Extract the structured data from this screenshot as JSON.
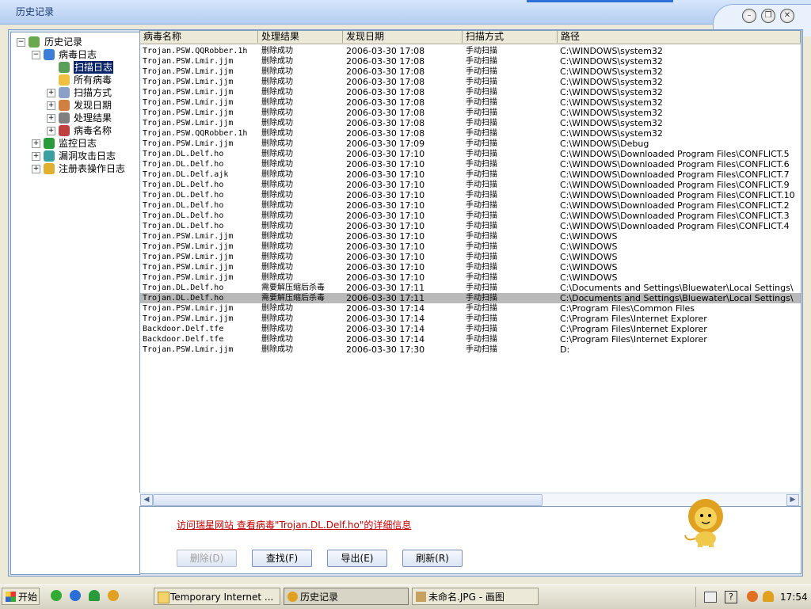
{
  "window": {
    "title": "历史记录"
  },
  "tree": [
    {
      "label": "历史记录"
    },
    {
      "label": "病毒日志"
    },
    {
      "label": "扫描日志"
    },
    {
      "label": "所有病毒"
    },
    {
      "label": "扫描方式"
    },
    {
      "label": "发现日期"
    },
    {
      "label": "处理结果"
    },
    {
      "label": "病毒名称"
    },
    {
      "label": "监控日志"
    },
    {
      "label": "漏洞攻击日志"
    },
    {
      "label": "注册表操作日志"
    }
  ],
  "columns": [
    "病毒名称",
    "处理结果",
    "发现日期",
    "扫描方式",
    "路径"
  ],
  "rows": [
    [
      "Trojan.PSW.QQRobber.1h",
      "删除成功",
      "2006-03-30  17:08",
      "手动扫描",
      "C:\\WINDOWS\\system32"
    ],
    [
      "Trojan.PSW.Lmir.jjm",
      "删除成功",
      "2006-03-30  17:08",
      "手动扫描",
      "C:\\WINDOWS\\system32"
    ],
    [
      "Trojan.PSW.Lmir.jjm",
      "删除成功",
      "2006-03-30  17:08",
      "手动扫描",
      "C:\\WINDOWS\\system32"
    ],
    [
      "Trojan.PSW.Lmir.jjm",
      "删除成功",
      "2006-03-30  17:08",
      "手动扫描",
      "C:\\WINDOWS\\system32"
    ],
    [
      "Trojan.PSW.Lmir.jjm",
      "删除成功",
      "2006-03-30  17:08",
      "手动扫描",
      "C:\\WINDOWS\\system32"
    ],
    [
      "Trojan.PSW.Lmir.jjm",
      "删除成功",
      "2006-03-30  17:08",
      "手动扫描",
      "C:\\WINDOWS\\system32"
    ],
    [
      "Trojan.PSW.Lmir.jjm",
      "删除成功",
      "2006-03-30  17:08",
      "手动扫描",
      "C:\\WINDOWS\\system32"
    ],
    [
      "Trojan.PSW.Lmir.jjm",
      "删除成功",
      "2006-03-30  17:08",
      "手动扫描",
      "C:\\WINDOWS\\system32"
    ],
    [
      "Trojan.PSW.QQRobber.1h",
      "删除成功",
      "2006-03-30  17:08",
      "手动扫描",
      "C:\\WINDOWS\\system32"
    ],
    [
      "Trojan.PSW.Lmir.jjm",
      "删除成功",
      "2006-03-30  17:09",
      "手动扫描",
      "C:\\WINDOWS\\Debug"
    ],
    [
      "Trojan.DL.Delf.ho",
      "删除成功",
      "2006-03-30  17:10",
      "手动扫描",
      "C:\\WINDOWS\\Downloaded Program Files\\CONFLICT.5"
    ],
    [
      "Trojan.DL.Delf.ho",
      "删除成功",
      "2006-03-30  17:10",
      "手动扫描",
      "C:\\WINDOWS\\Downloaded Program Files\\CONFLICT.6"
    ],
    [
      "Trojan.DL.Delf.ajk",
      "删除成功",
      "2006-03-30  17:10",
      "手动扫描",
      "C:\\WINDOWS\\Downloaded Program Files\\CONFLICT.7"
    ],
    [
      "Trojan.DL.Delf.ho",
      "删除成功",
      "2006-03-30  17:10",
      "手动扫描",
      "C:\\WINDOWS\\Downloaded Program Files\\CONFLICT.9"
    ],
    [
      "Trojan.DL.Delf.ho",
      "删除成功",
      "2006-03-30  17:10",
      "手动扫描",
      "C:\\WINDOWS\\Downloaded Program Files\\CONFLICT.10"
    ],
    [
      "Trojan.DL.Delf.ho",
      "删除成功",
      "2006-03-30  17:10",
      "手动扫描",
      "C:\\WINDOWS\\Downloaded Program Files\\CONFLICT.2"
    ],
    [
      "Trojan.DL.Delf.ho",
      "删除成功",
      "2006-03-30  17:10",
      "手动扫描",
      "C:\\WINDOWS\\Downloaded Program Files\\CONFLICT.3"
    ],
    [
      "Trojan.DL.Delf.ho",
      "删除成功",
      "2006-03-30  17:10",
      "手动扫描",
      "C:\\WINDOWS\\Downloaded Program Files\\CONFLICT.4"
    ],
    [
      "Trojan.PSW.Lmir.jjm",
      "删除成功",
      "2006-03-30  17:10",
      "手动扫描",
      "C:\\WINDOWS"
    ],
    [
      "Trojan.PSW.Lmir.jjm",
      "删除成功",
      "2006-03-30  17:10",
      "手动扫描",
      "C:\\WINDOWS"
    ],
    [
      "Trojan.PSW.Lmir.jjm",
      "删除成功",
      "2006-03-30  17:10",
      "手动扫描",
      "C:\\WINDOWS"
    ],
    [
      "Trojan.PSW.Lmir.jjm",
      "删除成功",
      "2006-03-30  17:10",
      "手动扫描",
      "C:\\WINDOWS"
    ],
    [
      "Trojan.PSW.Lmir.jjm",
      "删除成功",
      "2006-03-30  17:10",
      "手动扫描",
      "C:\\WINDOWS"
    ],
    [
      "Trojan.DL.Delf.ho",
      "需要解压缩后杀毒",
      "2006-03-30  17:11",
      "手动扫描",
      "C:\\Documents and Settings\\Bluewater\\Local Settings\\"
    ],
    [
      "Trojan.DL.Delf.ho",
      "需要解压缩后杀毒",
      "2006-03-30  17:11",
      "手动扫描",
      "C:\\Documents and Settings\\Bluewater\\Local Settings\\"
    ],
    [
      "Trojan.PSW.Lmir.jjm",
      "删除成功",
      "2006-03-30  17:14",
      "手动扫描",
      "C:\\Program Files\\Common Files"
    ],
    [
      "Trojan.PSW.Lmir.jjm",
      "删除成功",
      "2006-03-30  17:14",
      "手动扫描",
      "C:\\Program Files\\Internet Explorer"
    ],
    [
      "Backdoor.Delf.tfe",
      "删除成功",
      "2006-03-30  17:14",
      "手动扫描",
      "C:\\Program Files\\Internet Explorer"
    ],
    [
      "Backdoor.Delf.tfe",
      "删除成功",
      "2006-03-30  17:14",
      "手动扫描",
      "C:\\Program Files\\Internet Explorer"
    ],
    [
      "Trojan.PSW.Lmir.jjm",
      "删除成功",
      "2006-03-30  17:30",
      "手动扫描",
      "D:"
    ]
  ],
  "selected_row": 24,
  "info_link": "访问瑞星网站 查看病毒\"Trojan.DL.Delf.ho\"的详细信息",
  "buttons": {
    "delete": "删除(D)",
    "find": "查找(F)",
    "export": "导出(E)",
    "refresh": "刷新(R)"
  },
  "taskbar": {
    "start": "开始",
    "tasks": [
      "Temporary Internet ...",
      "历史记录",
      "未命名.JPG - 画图"
    ],
    "clock": "17:54"
  },
  "colors": {
    "selection": "#0a246a",
    "row_highlight": "#b9b9b9",
    "link": "#c00000"
  }
}
